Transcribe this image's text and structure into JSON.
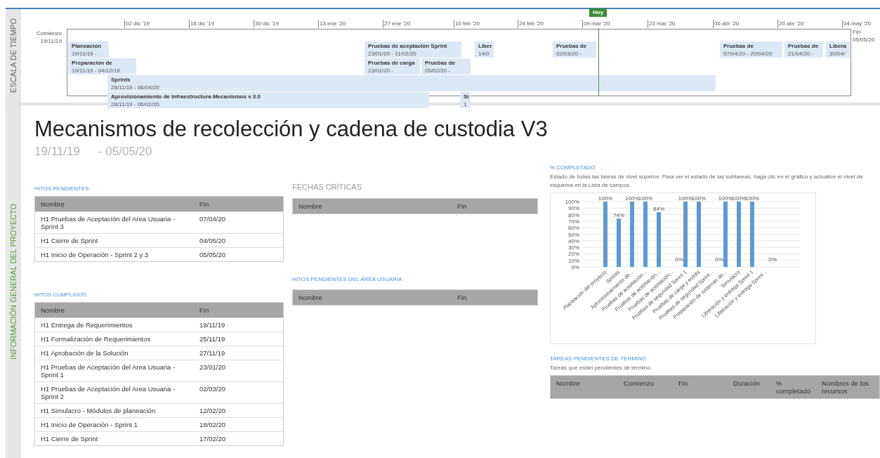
{
  "timeline": {
    "side_label": "ESCALA DE TIEMPO",
    "start_label": "Comienzo",
    "start_date": "19/11/19",
    "end_label": "Fin",
    "end_date": "05/05/20",
    "today_label": "Hoy",
    "ticks": [
      "02 dic '19",
      "16 dic '19",
      "30 dic '19",
      "13 ene '20",
      "27 ene '20",
      "10 feb '20",
      "24 feb '20",
      "09 mar '20",
      "23 mar '20",
      "06 abr '20",
      "20 abr '20",
      "04 may '20"
    ],
    "bars": [
      {
        "title": "Planeación",
        "dates": "19/11/19 -"
      },
      {
        "title": "Pruebas de aceptación Sprint",
        "dates": "23/01/20 - 11/02/20"
      },
      {
        "title": "Liber",
        "dates": "14/0"
      },
      {
        "title": "Pruebas de",
        "dates": "02/03/20 -"
      },
      {
        "title": "Pruebas de",
        "dates": "07/04/20 - 20/04/20"
      },
      {
        "title": "Pruebas de",
        "dates": "21/04/20 -"
      },
      {
        "title": "Libera",
        "dates": "30/04/"
      },
      {
        "title": "Preparación de",
        "dates": "19/11/19 - 04/12/19"
      },
      {
        "title": "Pruebas de carga",
        "dates": "23/01/20 -"
      },
      {
        "title": "Pruebas de",
        "dates": "05/02/20 -"
      },
      {
        "title": "Sprints",
        "dates": "28/11/19 - 06/04/20"
      },
      {
        "title": "Aprovisionamiento de Infraestructura Mecanismos v 3.0",
        "dates": "28/11/19 - 06/02/20"
      },
      {
        "title": "Si",
        "dates": "1"
      }
    ]
  },
  "project": {
    "side_label": "INFORMACIÓN GENERAL DEL PROYECTO",
    "title": "Mecanismos de recolección y cadena de custodia V3",
    "start": "19/11/19",
    "separator": "-",
    "end": "05/05/20"
  },
  "hitos_pendientes": {
    "title": "HITOS PENDIENTES",
    "columns": [
      "Nombre",
      "Fin"
    ],
    "rows": [
      [
        "H1 Pruebas de Aceptación del Area Usuaria - Sprint 3",
        "07/04/20"
      ],
      [
        "H1 Cierre de Sprint",
        "04/05/20"
      ],
      [
        "H1 Inicio de Operación - Sprint 2 y 3",
        "05/05/20"
      ]
    ]
  },
  "hitos_cumplidos": {
    "title": "HITOS CUMPLIDOS",
    "columns": [
      "Nombre",
      "Fin"
    ],
    "rows": [
      [
        "H1 Entrega de Requerimientos",
        "19/11/19"
      ],
      [
        "H1 Formalización de Requerimientos",
        "25/11/19"
      ],
      [
        "H1 Aprobación de la Solución",
        "27/11/19"
      ],
      [
        "H1 Pruebas de Aceptación del Area Usuaria - Sprint 1",
        "23/01/20"
      ],
      [
        "H1 Pruebas de Aceptación del Area Usuaria - Sprint 2",
        "02/03/20"
      ],
      [
        "H1 Simulacro - Módulos de planeación",
        "12/02/20"
      ],
      [
        "H1 Inicio de Operación - Sprint 1",
        "18/02/20"
      ],
      [
        "H1 Cierre de Sprint",
        "17/02/20"
      ]
    ]
  },
  "fechas_criticas": {
    "title": "FECHAS CRÍTICAS",
    "columns": [
      "Nombre",
      "Fin"
    ]
  },
  "hitos_area_usuaria": {
    "title": "HITOS PENDIENTES DEL ÁREA USUARIA",
    "columns": [
      "Nombre",
      "Fin"
    ]
  },
  "completado": {
    "title": "% COMPLETADO",
    "description": "Estado de todas las tareas de nivel superior. Para ver el estado de las subtareas, haga clic en el gráfico y actualice el nivel de esquema en la Lista de campos.",
    "chart_data": {
      "type": "bar",
      "categories": [
        "Planeación del proyecto",
        "Sprints",
        "Aprovisionamiento de...",
        "Pruebas de aceptación...",
        "Pruebas de aceptación...",
        "Pruebas de aceptación...",
        "Pruebas de seguridad Sprint 1",
        "Pruebas de carga y estrés",
        "Pruebas de seguridad Sprint...",
        "Preparación de sistemas de...",
        "Simulacro",
        "Liberación y entrega Sprint 1",
        "Liberación y entrega Sprint..."
      ],
      "series": [
        {
          "color": "#5b9bd5",
          "values": [
            100,
            74,
            100,
            100,
            84,
            0,
            100,
            100,
            0,
            100,
            100,
            100,
            0
          ]
        }
      ],
      "value_labels": [
        "100%",
        "74%",
        "100%",
        "100%",
        "84%",
        "0%",
        "100%",
        "100%",
        "0%",
        "100%",
        "100%",
        "100%",
        "0%"
      ],
      "grid": true,
      "ylim": [
        0,
        100
      ],
      "yticks": [
        {
          "value": 0,
          "label": "0%"
        },
        {
          "value": 10,
          "label": "10%"
        },
        {
          "value": 20,
          "label": "20%"
        },
        {
          "value": 30,
          "label": "30%"
        },
        {
          "value": 40,
          "label": "40%"
        },
        {
          "value": 50,
          "label": "50%"
        },
        {
          "value": 60,
          "label": "60%"
        },
        {
          "value": 70,
          "label": "70%"
        },
        {
          "value": 80,
          "label": "80%"
        },
        {
          "value": 90,
          "label": "90%"
        },
        {
          "value": 100,
          "label": "100%"
        }
      ]
    }
  },
  "tareas_pendientes": {
    "title": "TAREAS PENDIENTES DE TÉRMINO",
    "description": "Tareas que están pendientes de término.",
    "columns": [
      "Nombre",
      "Comienzo",
      "Fin",
      "Duración",
      "% completado",
      "Nombres de los recursos"
    ]
  }
}
